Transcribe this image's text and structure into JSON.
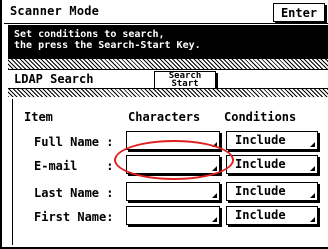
{
  "window": {
    "title": "Scanner Mode"
  },
  "toolbar": {
    "enter_label": "Enter"
  },
  "message": {
    "line1": "Set conditions to search,",
    "line2": "the press the Search-Start Key."
  },
  "ldap": {
    "label": "LDAP Search",
    "search_start_line1": "Search",
    "search_start_line2": "Start"
  },
  "table": {
    "headers": {
      "item": "Item",
      "characters": "Characters",
      "conditions": "Conditions"
    },
    "rows": [
      {
        "label": "Full Name :",
        "value": "",
        "condition": "Include"
      },
      {
        "label": "E-mail    :",
        "value": "",
        "condition": "Include"
      },
      {
        "label": "Last Name :",
        "value": "",
        "condition": "Include"
      },
      {
        "label": "First Name:",
        "value": "",
        "condition": "Include"
      }
    ]
  },
  "annotation": {
    "highlight_color": "#e02020"
  }
}
